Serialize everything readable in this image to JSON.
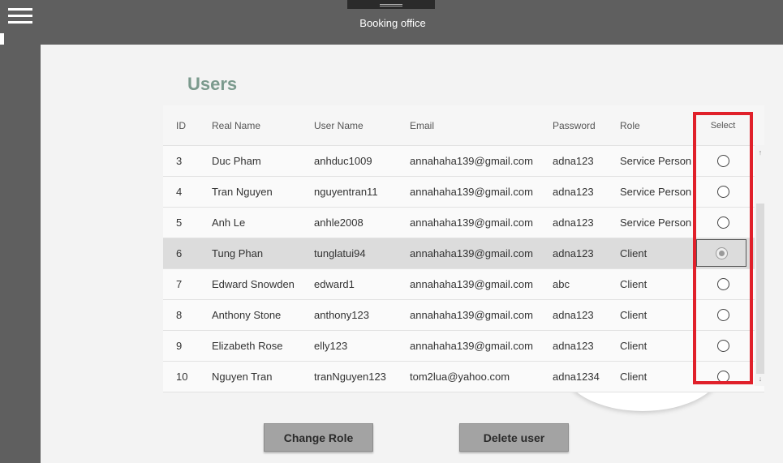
{
  "window": {
    "title": "Booking office"
  },
  "page": {
    "title": "Users"
  },
  "table": {
    "columns": {
      "id": "ID",
      "real_name": "Real Name",
      "user_name": "User Name",
      "email": "Email",
      "password": "Password",
      "role": "Role",
      "select": "Select"
    },
    "rows": [
      {
        "id": "3",
        "real_name": "Duc Pham",
        "user_name": "anhduc1009",
        "email": "annahaha139@gmail.com",
        "password": "adna123",
        "role": "Service Person",
        "selected": false
      },
      {
        "id": "4",
        "real_name": "Tran Nguyen",
        "user_name": "nguyentran11",
        "email": "annahaha139@gmail.com",
        "password": "adna123",
        "role": "Service Person",
        "selected": false
      },
      {
        "id": "5",
        "real_name": "Anh Le",
        "user_name": "anhle2008",
        "email": "annahaha139@gmail.com",
        "password": "adna123",
        "role": "Service Person",
        "selected": false
      },
      {
        "id": "6",
        "real_name": "Tung Phan",
        "user_name": "tunglatui94",
        "email": "annahaha139@gmail.com",
        "password": "adna123",
        "role": "Client",
        "selected": true
      },
      {
        "id": "7",
        "real_name": "Edward Snowden",
        "user_name": "edward1",
        "email": "annahaha139@gmail.com",
        "password": "abc",
        "role": "Client",
        "selected": false
      },
      {
        "id": "8",
        "real_name": "Anthony Stone",
        "user_name": "anthony123",
        "email": "annahaha139@gmail.com",
        "password": "adna123",
        "role": "Client",
        "selected": false
      },
      {
        "id": "9",
        "real_name": "Elizabeth Rose",
        "user_name": "elly123",
        "email": "annahaha139@gmail.com",
        "password": "adna123",
        "role": "Client",
        "selected": false
      },
      {
        "id": "10",
        "real_name": "Nguyen Tran",
        "user_name": "tranNguyen123",
        "email": "tom2lua@yahoo.com",
        "password": "adna1234",
        "role": "Client",
        "selected": false
      }
    ]
  },
  "scrollbar": {
    "up_glyph": "↑",
    "down_glyph": "↓"
  },
  "buttons": {
    "change_role": "Change Role",
    "delete_user": "Delete user"
  },
  "colors": {
    "title": "#7b9a8d",
    "highlight": "#e0202a",
    "chrome": "#5f5f5f"
  },
  "icons": {
    "menu": "hamburger-menu-icon",
    "radio": "radio-button-icon"
  }
}
